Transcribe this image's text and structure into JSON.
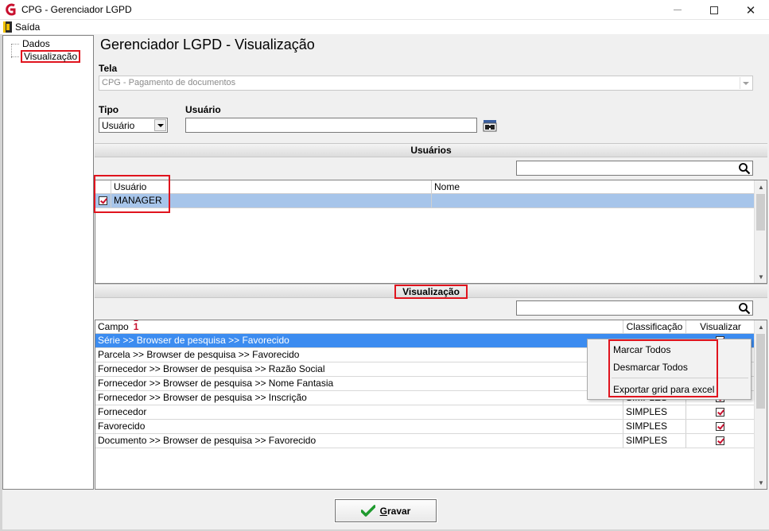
{
  "window": {
    "title": "CPG - Gerenciador LGPD",
    "minimize_label": "",
    "close_symbol": "✕"
  },
  "menu": {
    "exit_label": "Saída"
  },
  "tree": {
    "items": [
      {
        "label": "Dados",
        "selected": false
      },
      {
        "label": "Visualização",
        "selected": true
      }
    ]
  },
  "page": {
    "title": "Gerenciador LGPD - Visualização"
  },
  "form": {
    "tela_label": "Tela",
    "tela_value": "CPG - Pagamento de documentos",
    "tipo_label": "Tipo",
    "tipo_value": "Usuário",
    "usuario_label": "Usuário",
    "usuario_value": ""
  },
  "users_section": {
    "title": "Usuários",
    "search_value": "",
    "columns": [
      "Usuário",
      "Nome"
    ],
    "rows": [
      {
        "checked": true,
        "usuario": "MANAGER",
        "nome": ""
      }
    ]
  },
  "view_section": {
    "title": "Visualização",
    "search_value": "",
    "columns": {
      "campo": "Campo",
      "sort_indicator": "1",
      "classificacao": "Classificação",
      "visualizar": "Visualizar"
    },
    "rows": [
      {
        "campo": "Série >> Browser de pesquisa >> Favorecido",
        "classificacao": "",
        "visualizar": true,
        "selected": true
      },
      {
        "campo": "Parcela >> Browser de pesquisa >> Favorecido",
        "classificacao": "",
        "visualizar": true,
        "selected": false
      },
      {
        "campo": "Fornecedor >> Browser de pesquisa >> Razão Social",
        "classificacao": "",
        "visualizar": true,
        "selected": false
      },
      {
        "campo": "Fornecedor >> Browser de pesquisa >> Nome Fantasia",
        "classificacao": "",
        "visualizar": true,
        "selected": false
      },
      {
        "campo": "Fornecedor >> Browser de pesquisa >> Inscrição",
        "classificacao": "SIMPLES",
        "visualizar": true,
        "selected": false
      },
      {
        "campo": "Fornecedor",
        "classificacao": "SIMPLES",
        "visualizar": true,
        "selected": false
      },
      {
        "campo": "Favorecido",
        "classificacao": "SIMPLES",
        "visualizar": true,
        "selected": false
      },
      {
        "campo": "Documento >> Browser de pesquisa >> Favorecido",
        "classificacao": "SIMPLES",
        "visualizar": true,
        "selected": false
      }
    ]
  },
  "context_menu": {
    "items": [
      "Marcar Todos",
      "Desmarcar Todos",
      "Exportar grid para excel"
    ]
  },
  "footer": {
    "save_prefix": "G",
    "save_rest": "ravar"
  },
  "colors": {
    "highlight_red": "#e0141e",
    "selection_blue": "#3c8cf0",
    "user_row_blue": "#a7c5ea"
  }
}
